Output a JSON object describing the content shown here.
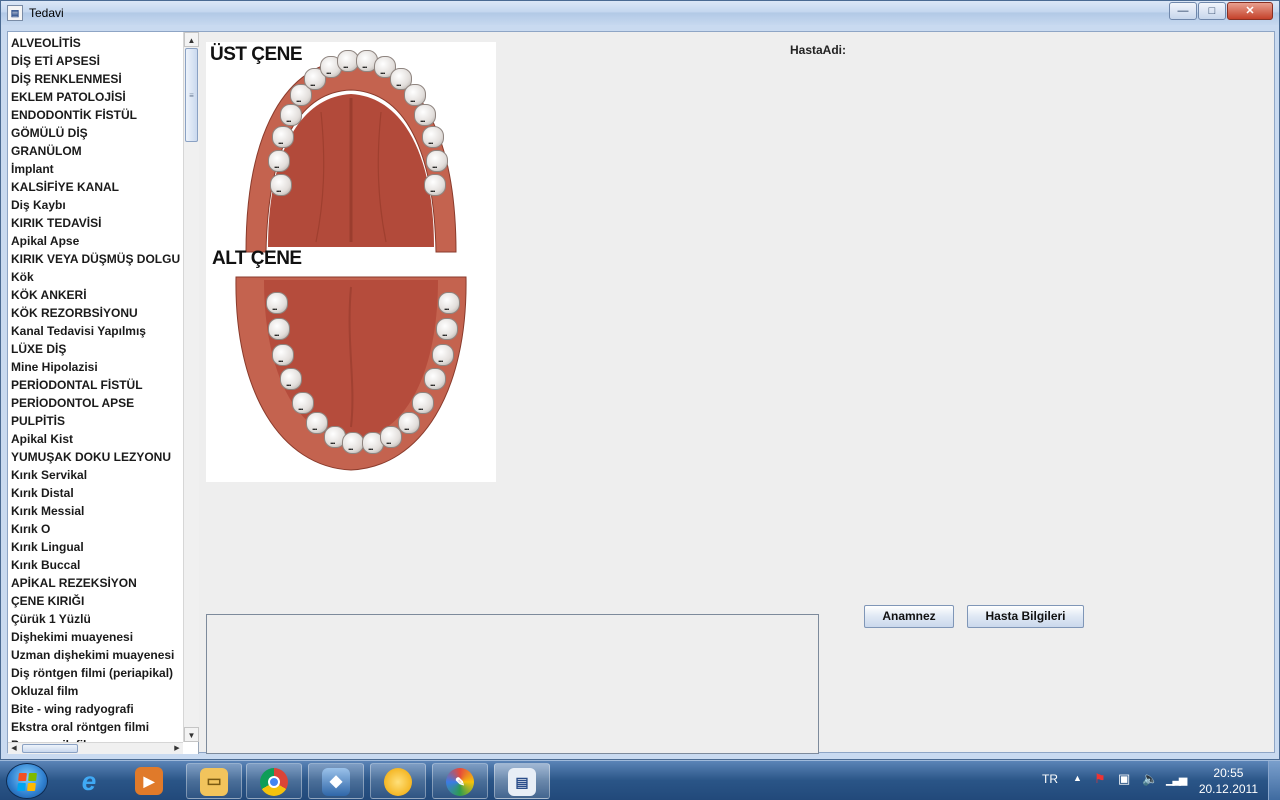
{
  "window": {
    "title": "Tedavi",
    "app_icon": "app-form-icon"
  },
  "titlebar_buttons": {
    "minimize": "—",
    "maximize": "□",
    "close": "✕"
  },
  "diagnosis_list": [
    "ALVEOLİTİS",
    "DİŞ ETİ APSESİ",
    "DİŞ RENKLENMESİ",
    "EKLEM PATOLOJİSİ",
    "ENDODONTİK FİSTÜL",
    "GÖMÜLÜ DİŞ",
    "GRANÜLOM",
    "İmplant",
    "KALSİFİYE KANAL",
    "Diş Kaybı",
    "KIRIK TEDAVİSİ",
    "Apikal Apse",
    "KIRIK VEYA DÜŞMÜŞ DOLGU",
    "Kök",
    "KÖK ANKERİ",
    "KÖK REZORBSİYONU",
    "Kanal Tedavisi Yapılmış",
    "LÜXE DİŞ",
    "Mine Hipolazisi",
    "PERİODONTAL FİSTÜL",
    "PERİODONTOL APSE",
    "PULPİTİS",
    "Apikal Kist",
    "YUMUŞAK DOKU LEZYONU",
    "Kırık Servikal",
    "Kırık Distal",
    "Kırık Messial",
    "Kırık O",
    "Kırık Lingual",
    "Kırık Buccal",
    "APİKAL REZEKSİYON",
    "ÇENE KIRIĞI",
    "Çürük 1 Yüzlü",
    "Dişhekimi muayenesi",
    "Uzman dişhekimi muayenesi",
    "Diş röntgen filmi (periapikal)",
    "Okluzal film",
    "Bite - wing radyografi",
    "Ekstra oral röntgen filmi",
    "Panoramik film"
  ],
  "dental_chart": {
    "upper_label": "ÜST ÇENE",
    "lower_label": "ALT ÇENE",
    "tooth_mark": "...",
    "upper_teeth_count": 16,
    "lower_teeth_count": 16
  },
  "patient": {
    "name_label": "HastaAdi:"
  },
  "buttons": {
    "anamnez": "Anamnez",
    "hasta_bilgileri": "Hasta Bilgileri"
  },
  "taskbar": {
    "items": [
      "ie-icon",
      "media-player-icon",
      "file-explorer-icon",
      "chrome-icon",
      "virtualbox-icon",
      "app-orange-icon",
      "paint-icon",
      "tedavi-app-icon"
    ],
    "language": "TR",
    "time": "20:55",
    "date": "20.12.2011"
  },
  "colors": {
    "taskbar": "#2a5587",
    "window_frame": "#c9daf0",
    "client_bg": "#eeeeee",
    "gum": "#c4634f"
  }
}
